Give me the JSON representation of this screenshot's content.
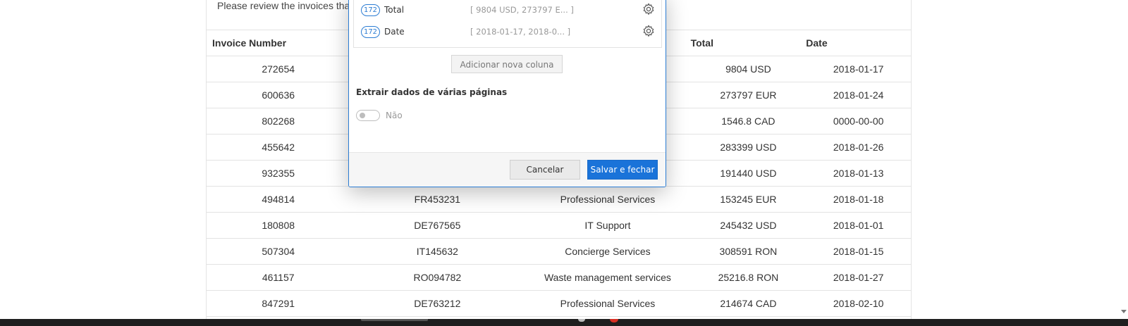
{
  "page": {
    "intro_text": "Please review the invoices tha"
  },
  "table": {
    "headers": [
      "Invoice Number",
      "",
      "",
      "Total",
      "Date"
    ],
    "rows": [
      [
        "272654",
        "",
        "",
        "9804 USD",
        "2018-01-17"
      ],
      [
        "600636",
        "",
        "",
        "273797 EUR",
        "2018-01-24"
      ],
      [
        "802268",
        "",
        "",
        "1546.8 CAD",
        "0000-00-00"
      ],
      [
        "455642",
        "",
        "",
        "283399 USD",
        "2018-01-26"
      ],
      [
        "932355",
        "",
        "",
        "191440 USD",
        "2018-01-13"
      ],
      [
        "494814",
        "FR453231",
        "Professional Services",
        "153245 EUR",
        "2018-01-18"
      ],
      [
        "180808",
        "DE767565",
        "IT Support",
        "245432 USD",
        "2018-01-01"
      ],
      [
        "507304",
        "IT145632",
        "Concierge Services",
        "308591 RON",
        "2018-01-15"
      ],
      [
        "461157",
        "RO094782",
        "Waste management services",
        "25216.8 RON",
        "2018-01-27"
      ],
      [
        "847291",
        "DE763212",
        "Professional Services",
        "214674 CAD",
        "2018-02-10"
      ]
    ]
  },
  "dialog": {
    "columns": [
      {
        "count": "172",
        "name": "Total",
        "preview": "[ 9804 USD, 273797 E... ]",
        "icon": "gear-icon"
      },
      {
        "count": "172",
        "name": "Date",
        "preview": "[ 2018-01-17, 2018-0... ]",
        "icon": "gear-icon"
      }
    ],
    "add_column_label": "Adicionar nova coluna",
    "multi_page_label": "Extrair dados de várias páginas",
    "toggle_label": "Não",
    "toggle_on": false,
    "cancel_label": "Cancelar",
    "save_label": "Salvar e fechar"
  },
  "colors": {
    "accent": "#1a73d9",
    "border": "#e3e3e3",
    "taskbar": "#1f1f1f"
  }
}
